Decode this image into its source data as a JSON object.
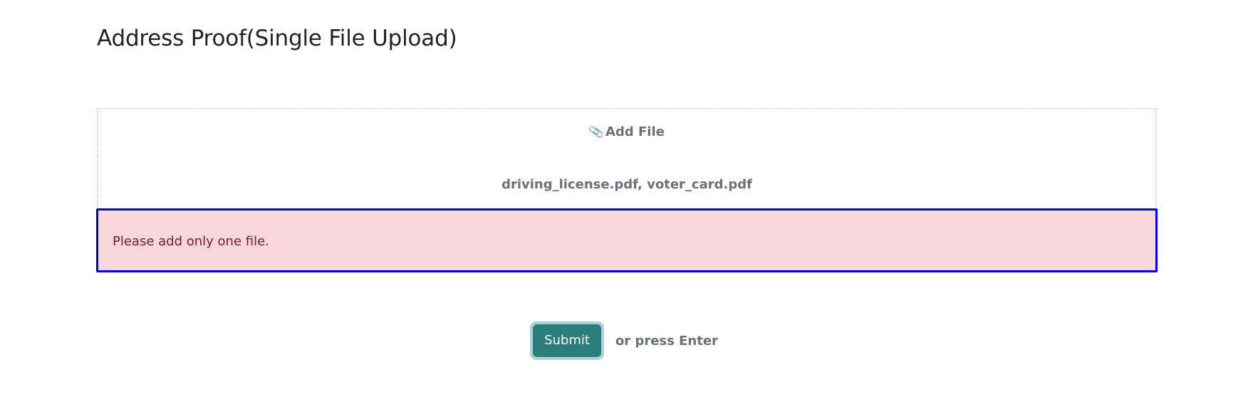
{
  "form": {
    "title": "Address Proof(Single File Upload)",
    "add_file_icon": "paperclip-icon",
    "add_file_label": "Add File",
    "selected_files": "driving_license.pdf, voter_card.pdf",
    "error_message": "Please add only one file.",
    "submit_label": "Submit",
    "submit_hint": "or press Enter"
  },
  "colors": {
    "accent": "#2e7d7d",
    "error_bg": "#f7d7dc",
    "error_border": "#0000e6",
    "error_text": "#7a1c24",
    "dropzone_border": "#8fd1cf"
  }
}
